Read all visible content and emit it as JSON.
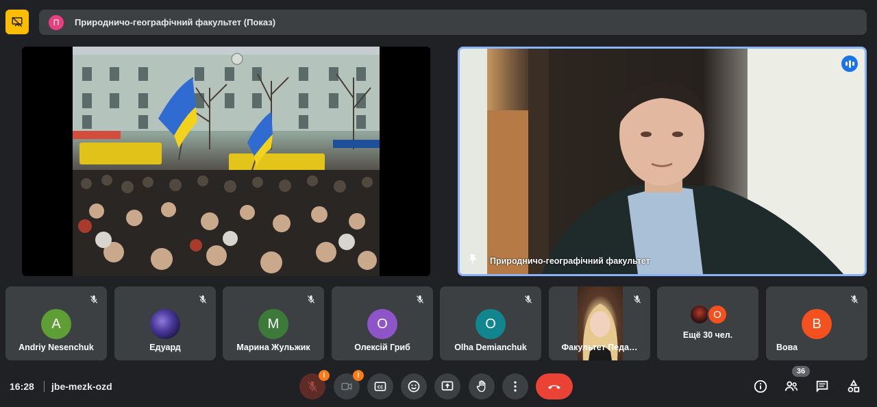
{
  "header": {
    "avatar_letter": "П",
    "title": "Природничо-географічний факультет (Показ)",
    "avatar_color": "#e8407f"
  },
  "presenter": {
    "name": "Природничо-географічний факультет"
  },
  "participants": [
    {
      "name": "Andriy Nesenchuk",
      "initial": "A",
      "color": "#5e9e35"
    },
    {
      "name": "Едуард",
      "initial": "",
      "color": "#3a2f7a"
    },
    {
      "name": "Марина Жульжик",
      "initial": "М",
      "color": "#3d7a3a"
    },
    {
      "name": "Олексій Гриб",
      "initial": "О",
      "color": "#8e55c9"
    },
    {
      "name": "Olha Demianchuk",
      "initial": "O",
      "color": "#12868f"
    },
    {
      "name": "Факультет Педа…",
      "initial": "",
      "color": ""
    },
    {
      "name": "Ещё 30 чел.",
      "initial": "О",
      "color": "#f4511e"
    },
    {
      "name": "Вова",
      "initial": "В",
      "color": "#f4511e"
    }
  ],
  "footer": {
    "time": "16:28",
    "meeting_code": "jbe-mezk-ozd",
    "people_count": "36"
  },
  "icons": {
    "present": "presentation-off-icon",
    "mic_off": "mic-off-icon",
    "camera_off": "camera-off-icon",
    "captions": "captions-icon",
    "emoji": "emoji-icon",
    "present_screen": "present-screen-icon",
    "raise_hand": "raise-hand-icon",
    "more": "more-vert-icon",
    "hangup": "hangup-icon",
    "info": "info-icon",
    "people": "people-icon",
    "chat": "chat-icon",
    "activities": "activities-icon"
  },
  "colors": {
    "background": "#202124",
    "tile": "#3c4043",
    "accent_present": "#fbbc04",
    "hangup": "#ea4335",
    "speaking": "#1a73e8"
  }
}
